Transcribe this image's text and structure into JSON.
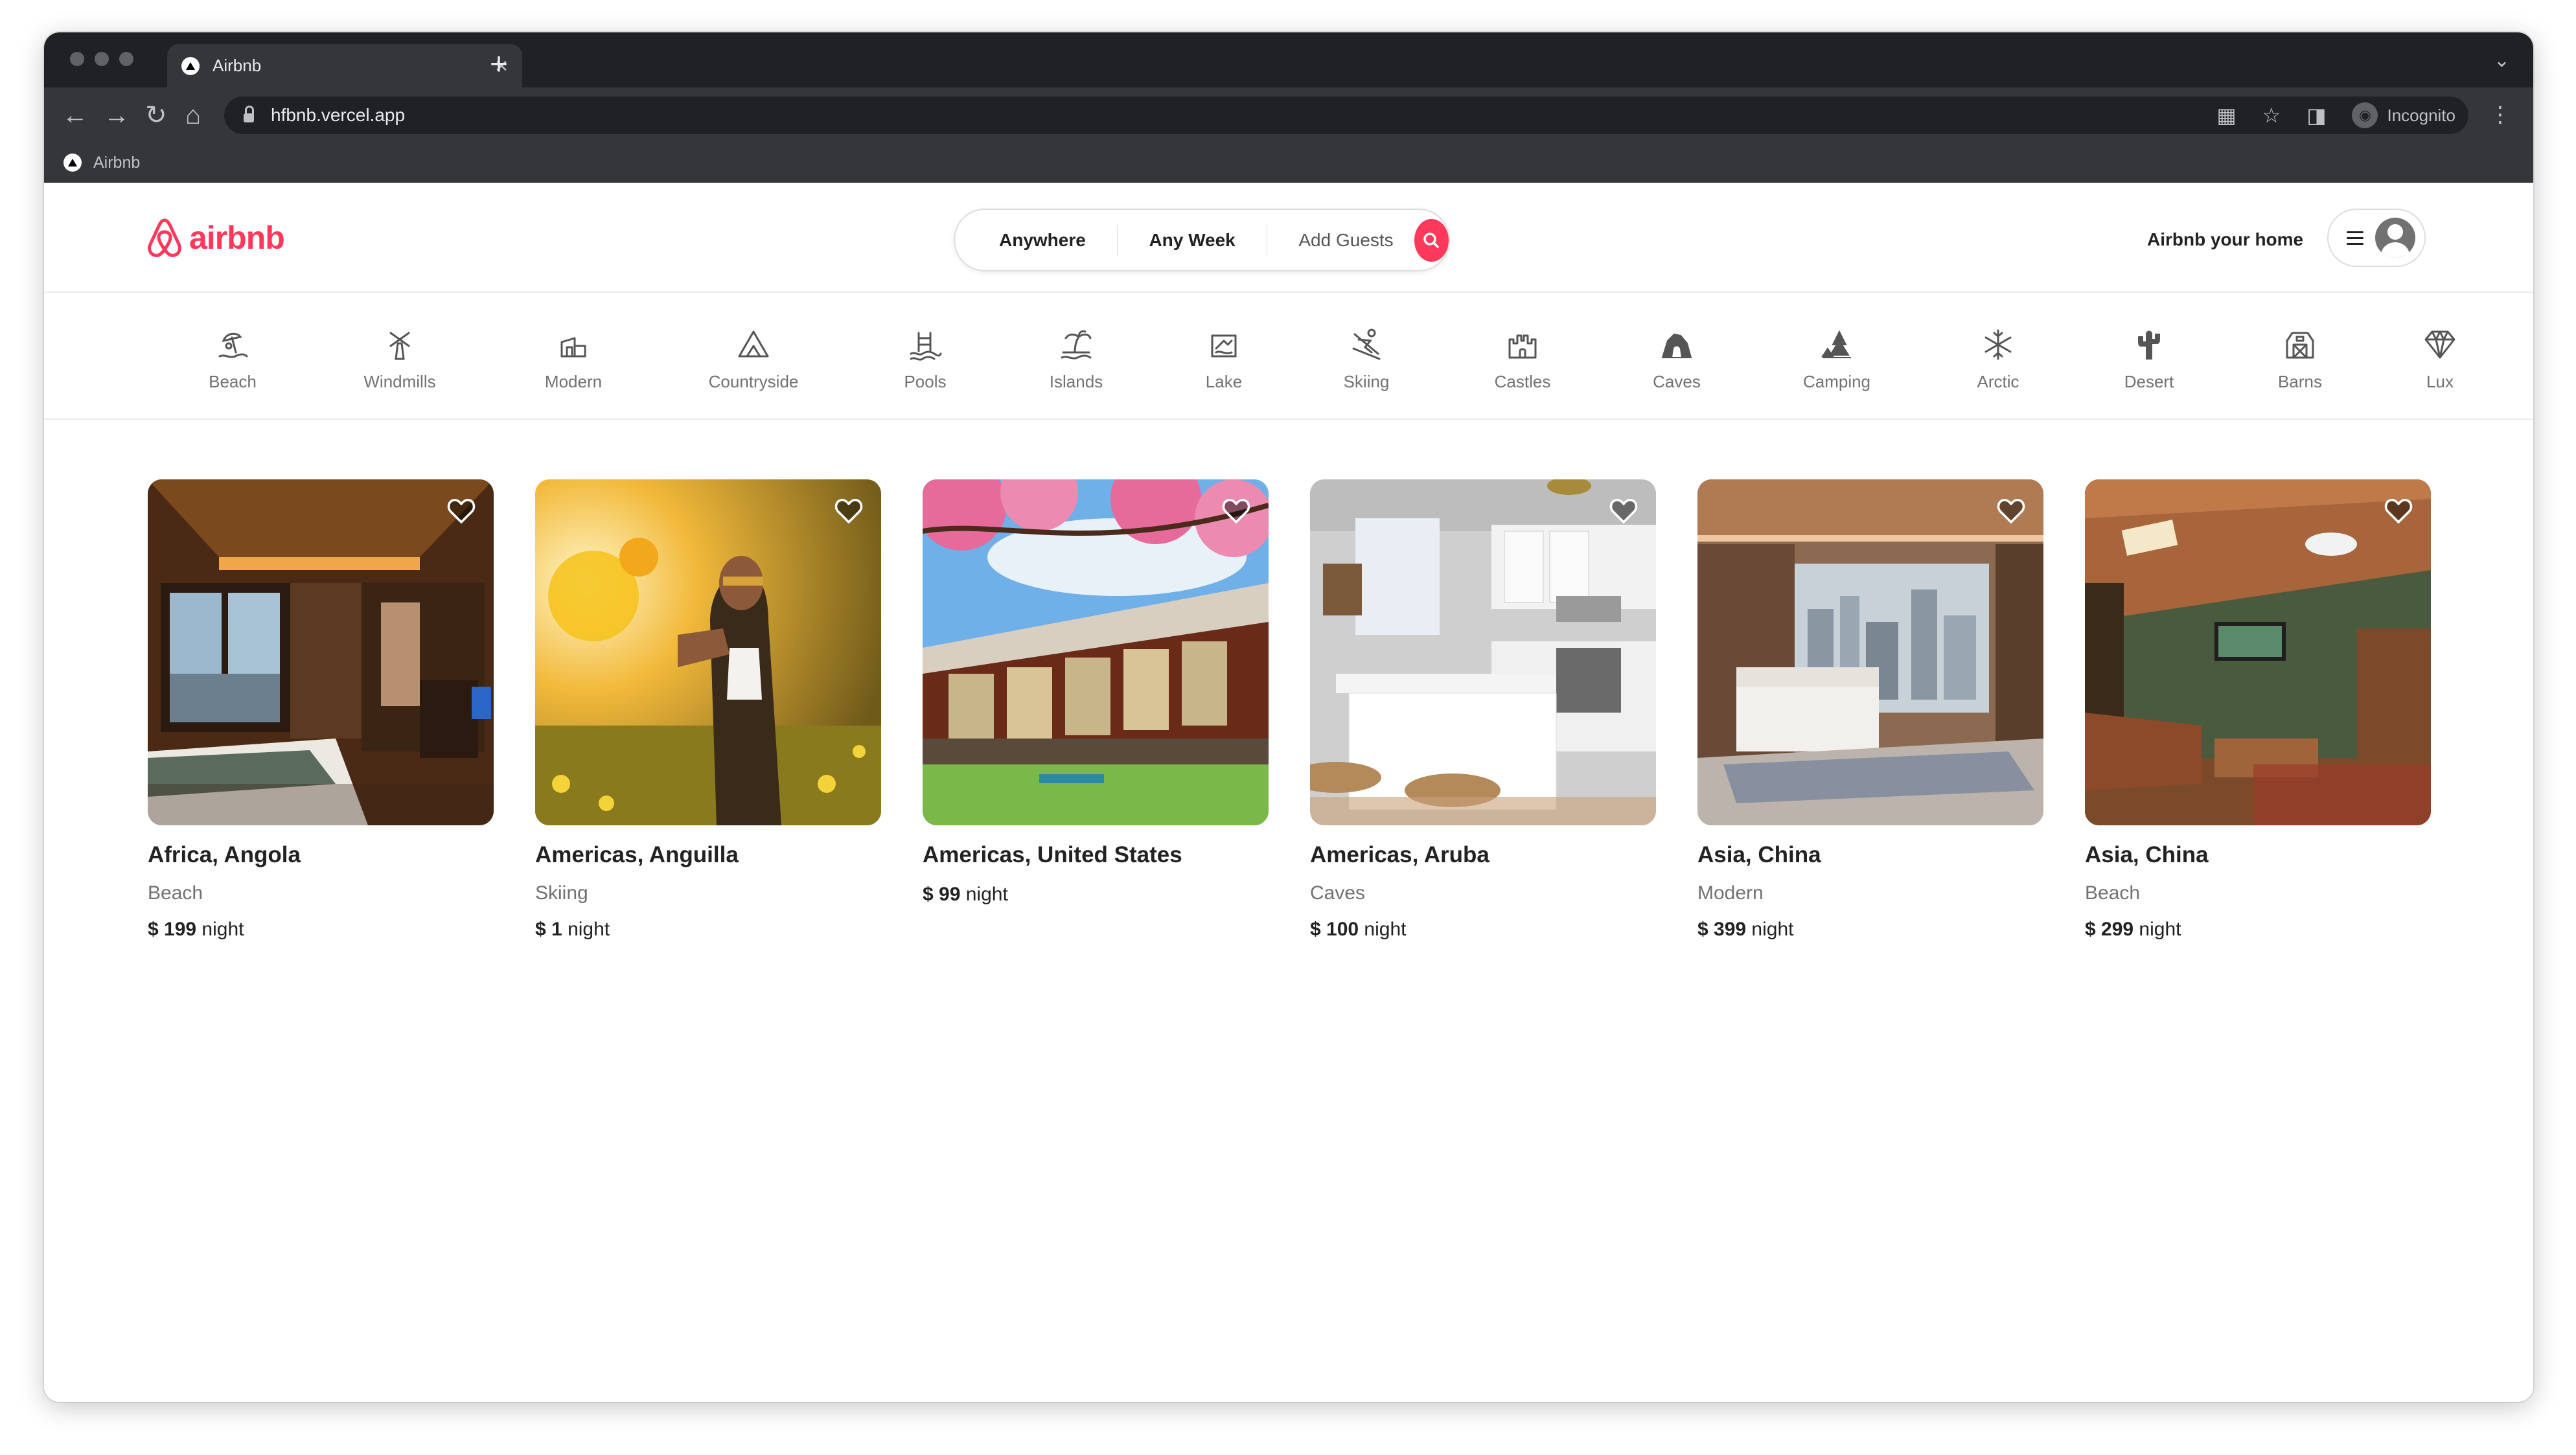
{
  "browser": {
    "tab_title": "Airbnb",
    "tab_close": "×",
    "new_tab": "+",
    "url": "hfbnb.vercel.app",
    "profile_label": "Incognito",
    "bookmark_label": "Airbnb"
  },
  "header": {
    "logo_text": "airbnb",
    "brand_color": "#FF385C",
    "search": {
      "where": "Anywhere",
      "when": "Any Week",
      "who": "Add Guests"
    },
    "host_link": "Airbnb your home"
  },
  "categories": [
    {
      "label": "Beach",
      "icon": "beach-icon"
    },
    {
      "label": "Windmills",
      "icon": "windmill-icon"
    },
    {
      "label": "Modern",
      "icon": "modern-house-icon"
    },
    {
      "label": "Countryside",
      "icon": "mountain-icon"
    },
    {
      "label": "Pools",
      "icon": "pool-icon"
    },
    {
      "label": "Islands",
      "icon": "island-icon"
    },
    {
      "label": "Lake",
      "icon": "lake-icon"
    },
    {
      "label": "Skiing",
      "icon": "skiing-icon"
    },
    {
      "label": "Castles",
      "icon": "castle-icon"
    },
    {
      "label": "Caves",
      "icon": "cave-icon"
    },
    {
      "label": "Camping",
      "icon": "camping-icon"
    },
    {
      "label": "Arctic",
      "icon": "snowflake-icon"
    },
    {
      "label": "Desert",
      "icon": "cactus-icon"
    },
    {
      "label": "Barns",
      "icon": "barn-icon"
    },
    {
      "label": "Lux",
      "icon": "diamond-icon"
    }
  ],
  "listings": [
    {
      "title": "Africa, Angola",
      "category": "Beach",
      "price": "$ 199",
      "unit": "night"
    },
    {
      "title": "Americas, Anguilla",
      "category": "Skiing",
      "price": "$ 1",
      "unit": "night"
    },
    {
      "title": "Americas, United States",
      "category": "",
      "price": "$ 99",
      "unit": "night"
    },
    {
      "title": "Americas, Aruba",
      "category": "Caves",
      "price": "$ 100",
      "unit": "night"
    },
    {
      "title": "Asia, China",
      "category": "Modern",
      "price": "$ 399",
      "unit": "night"
    },
    {
      "title": "Asia, China",
      "category": "Beach",
      "price": "$ 299",
      "unit": "night"
    }
  ]
}
